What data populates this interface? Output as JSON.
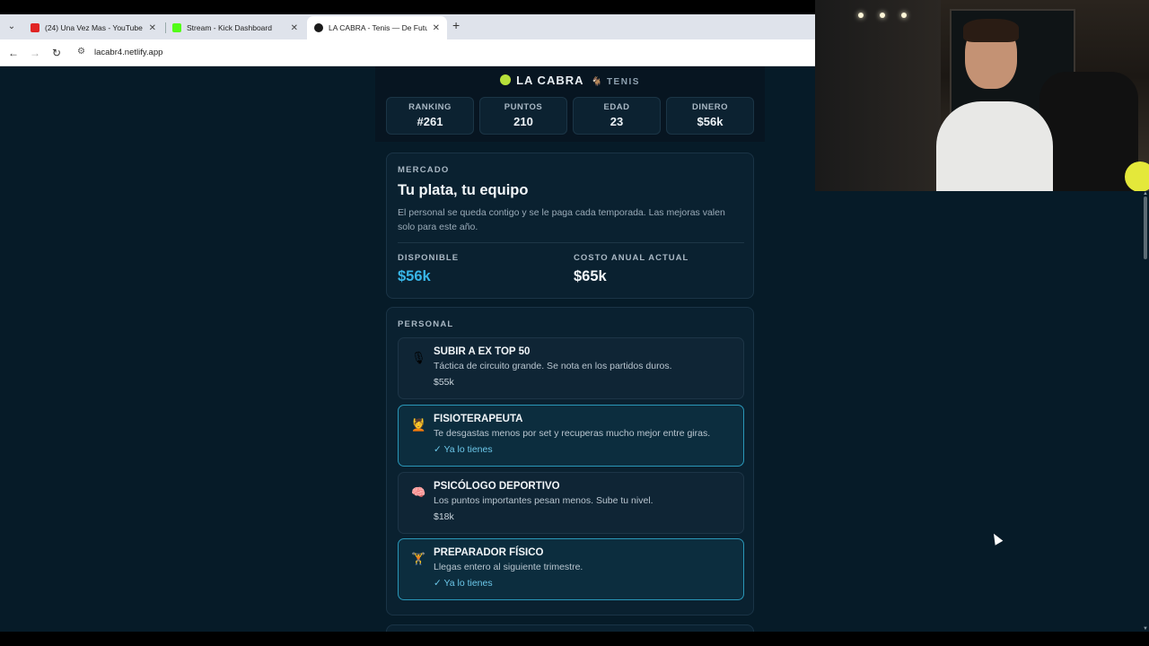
{
  "browser": {
    "tabs": [
      {
        "title": "(24) Una Vez Mas - YouTube",
        "favicon_color": "#e02424"
      },
      {
        "title": "Stream - Kick Dashboard",
        "favicon_color": "#53fc18"
      },
      {
        "title": "LA CABRA - Tenis — De Futures",
        "favicon_color": "#1a1a1a"
      }
    ],
    "url": "lacabr4.netlify.app"
  },
  "header": {
    "brand": "LA CABRA",
    "subtitle": "TENIS",
    "stats": [
      {
        "label": "RANKING",
        "value": "#261"
      },
      {
        "label": "PUNTOS",
        "value": "210"
      },
      {
        "label": "EDAD",
        "value": "23"
      },
      {
        "label": "DINERO",
        "value": "$56k"
      }
    ]
  },
  "market": {
    "section_label": "MERCADO",
    "title": "Tu plata, tu equipo",
    "description": "El personal se queda contigo y se le paga cada temporada. Las mejoras valen solo para este año.",
    "available_label": "DISPONIBLE",
    "available_value": "$56k",
    "cost_label": "COSTO ANUAL ACTUAL",
    "cost_value": "$65k",
    "available_color": "#38b6e8"
  },
  "staff": {
    "section_label": "PERSONAL",
    "items": [
      {
        "name": "SUBIR A EX TOP 50",
        "desc": "Táctica de circuito grande. Se nota en los partidos duros.",
        "price": "$55k",
        "icon": "coach-icon",
        "glyph": "🎙"
      },
      {
        "name": "FISIOTERAPEUTA",
        "desc": "Te desgastas menos por set y recuperas mucho mejor entre giras.",
        "status": "✓ Ya lo tienes",
        "icon": "physio-icon",
        "glyph": "💆"
      },
      {
        "name": "PSICÓLOGO DEPORTIVO",
        "desc": "Los puntos importantes pesan menos. Sube tu nivel.",
        "price": "$18k",
        "icon": "brain-icon",
        "glyph": "🧠"
      },
      {
        "name": "PREPARADOR FÍSICO",
        "desc": "Llegas entero al siguiente trimestre.",
        "status": "✓ Ya lo tienes",
        "icon": "weightlifter-icon",
        "glyph": "🏋"
      }
    ]
  }
}
